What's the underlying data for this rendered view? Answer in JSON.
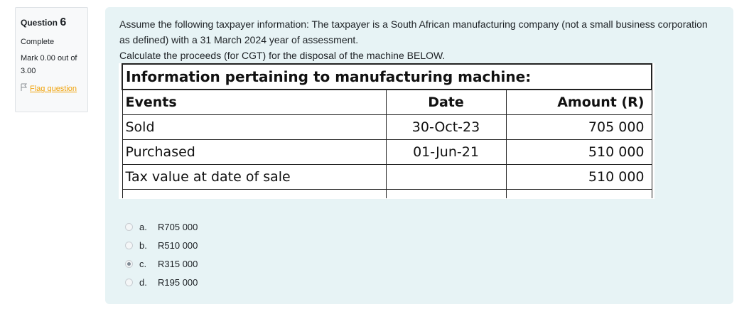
{
  "info": {
    "question_label": "Question",
    "question_number": "6",
    "state": "Complete",
    "mark": "Mark 0.00 out of 3.00",
    "flag_label": "Flag question"
  },
  "question": {
    "line1": "Assume the following taxpayer information: The taxpayer is a South African manufacturing company (not a small business corporation as defined) with a 31 March 2024 year of assessment.",
    "line2": "Calculate the proceeds (for CGT) for the disposal of the machine BELOW."
  },
  "table": {
    "title": "Information pertaining to manufacturing machine:",
    "headers": [
      "Events",
      "Date",
      "Amount (R)"
    ],
    "rows": [
      [
        "Sold",
        "30-Oct-23",
        "705 000"
      ],
      [
        "Purchased",
        "01-Jun-21",
        "510 000"
      ],
      [
        "Tax value at date of sale",
        "",
        "510 000"
      ]
    ]
  },
  "answers": [
    {
      "letter": "a.",
      "text": "R705 000",
      "selected": false
    },
    {
      "letter": "b.",
      "text": "R510 000",
      "selected": false
    },
    {
      "letter": "c.",
      "text": "R315 000",
      "selected": true
    },
    {
      "letter": "d.",
      "text": "R195 000",
      "selected": false
    }
  ]
}
